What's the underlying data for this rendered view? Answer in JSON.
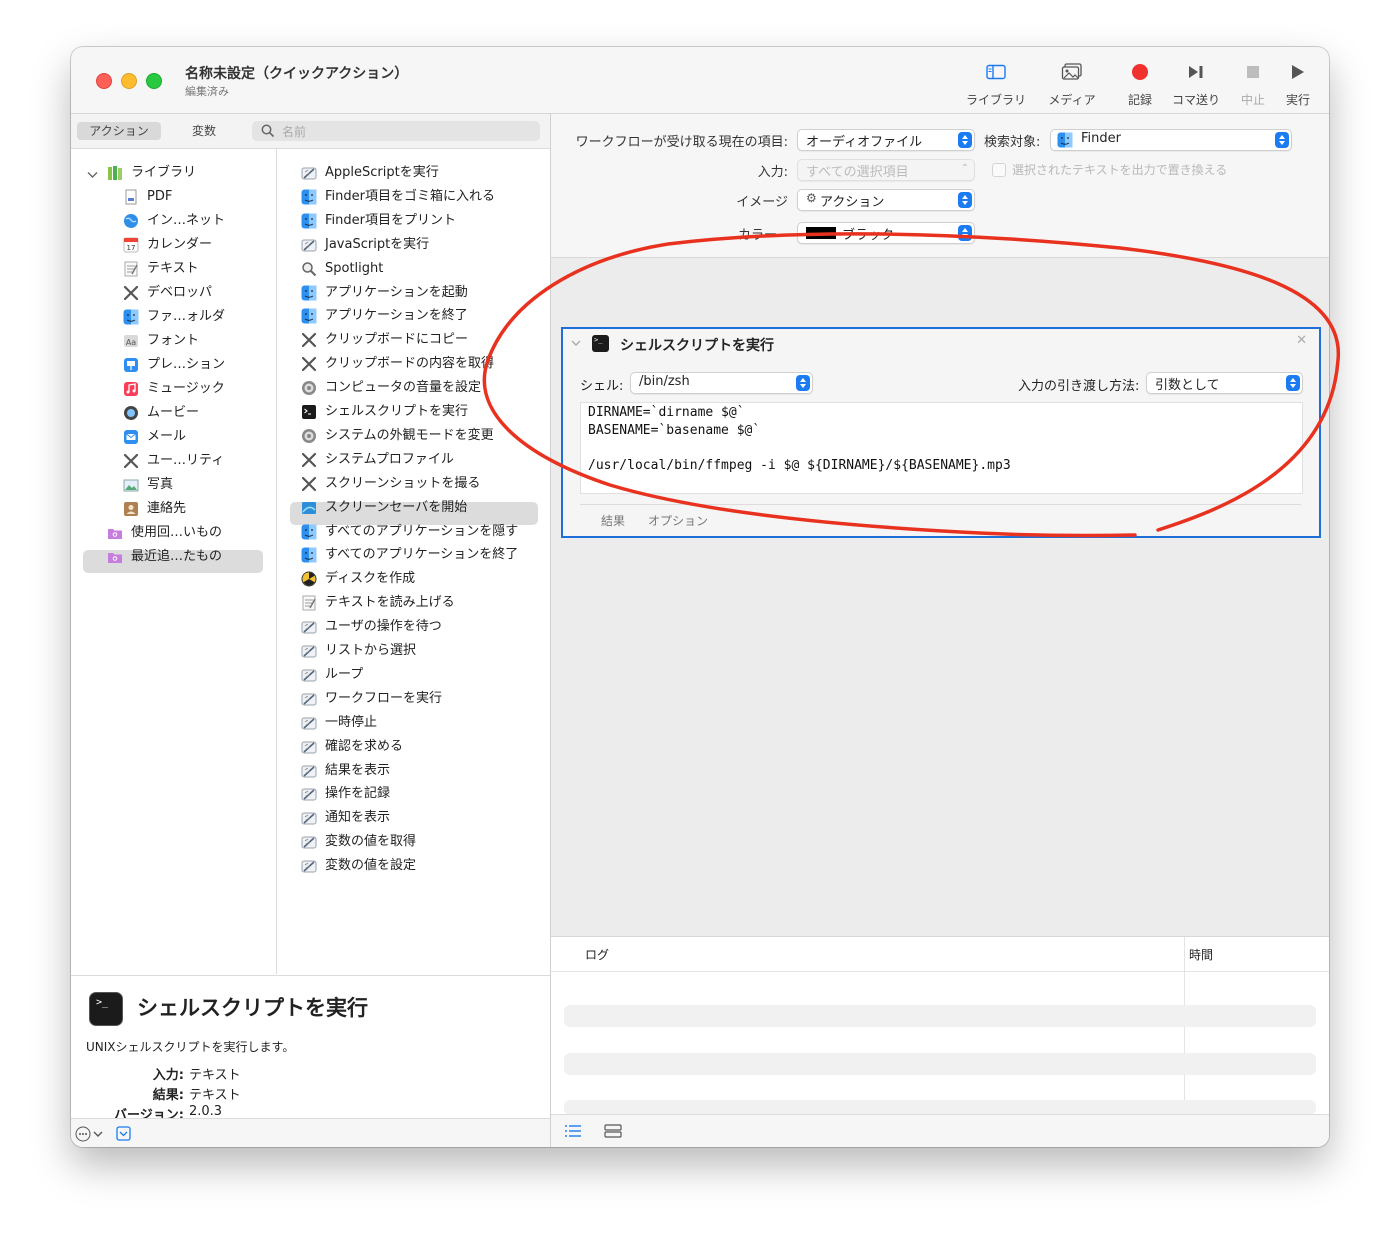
{
  "window": {
    "title": "名称未設定（クイックアクション）",
    "subtitle": "編集済み"
  },
  "toolbar": [
    {
      "label": "ライブラリ",
      "icon": "sidebar-icon"
    },
    {
      "label": "メディア",
      "icon": "media-icon"
    },
    {
      "label": "記録",
      "icon": "record-icon"
    },
    {
      "label": "コマ送り",
      "icon": "step-icon"
    },
    {
      "label": "中止",
      "icon": "stop-icon",
      "disabled": true
    },
    {
      "label": "実行",
      "icon": "play-icon"
    }
  ],
  "left_panel": {
    "segments": [
      "アクション",
      "変数"
    ],
    "selected_segment": "アクション",
    "search_placeholder": "名前"
  },
  "library": [
    {
      "label": "ライブラリ",
      "icon": "library-icon"
    },
    {
      "label": "PDF",
      "icon": "pdf-icon"
    },
    {
      "label": "イン…ネット",
      "icon": "globe-icon"
    },
    {
      "label": "カレンダー",
      "icon": "calendar-icon"
    },
    {
      "label": "テキスト",
      "icon": "text-icon"
    },
    {
      "label": "デベロッパ",
      "icon": "tools-icon"
    },
    {
      "label": "ファ…ォルダ",
      "icon": "finder-icon"
    },
    {
      "label": "フォント",
      "icon": "font-icon"
    },
    {
      "label": "プレ…ション",
      "icon": "keynote-icon"
    },
    {
      "label": "ミュージック",
      "icon": "music-icon"
    },
    {
      "label": "ムービー",
      "icon": "movie-icon"
    },
    {
      "label": "メール",
      "icon": "mail-icon"
    },
    {
      "label": "ユー…リティ",
      "icon": "tools-icon"
    },
    {
      "label": "写真",
      "icon": "photo-icon"
    },
    {
      "label": "連絡先",
      "icon": "contacts-icon"
    },
    {
      "label": "使用回…いもの",
      "icon": "smart-folder-icon"
    },
    {
      "label": "最近追…たもの",
      "icon": "smart-folder-icon"
    }
  ],
  "actions": [
    {
      "label": "AppleScriptを実行",
      "icon": "automator-icon"
    },
    {
      "label": "Finder項目をゴミ箱に入れる",
      "icon": "finder-icon"
    },
    {
      "label": "Finder項目をプリント",
      "icon": "finder-icon"
    },
    {
      "label": "JavaScriptを実行",
      "icon": "automator-icon"
    },
    {
      "label": "Spotlight",
      "icon": "magnifier-icon"
    },
    {
      "label": "アプリケーションを起動",
      "icon": "finder-icon"
    },
    {
      "label": "アプリケーションを終了",
      "icon": "finder-icon"
    },
    {
      "label": "クリップボードにコピー",
      "icon": "tools-icon"
    },
    {
      "label": "クリップボードの内容を取得",
      "icon": "tools-icon"
    },
    {
      "label": "コンピュータの音量を設定",
      "icon": "gear-icon"
    },
    {
      "label": "シェルスクリプトを実行",
      "icon": "terminal-icon"
    },
    {
      "label": "システムの外観モードを変更",
      "icon": "gear-icon"
    },
    {
      "label": "システムプロファイル",
      "icon": "tools-icon"
    },
    {
      "label": "スクリーンショットを撮る",
      "icon": "tools-icon"
    },
    {
      "label": "スクリーンセーバを開始",
      "icon": "screensaver-icon"
    },
    {
      "label": "すべてのアプリケーションを隠す",
      "icon": "finder-icon"
    },
    {
      "label": "すべてのアプリケーションを終了",
      "icon": "finder-icon"
    },
    {
      "label": "ディスクを作成",
      "icon": "disk-icon"
    },
    {
      "label": "テキストを読み上げる",
      "icon": "text-icon"
    },
    {
      "label": "ユーザの操作を待つ",
      "icon": "automator-icon"
    },
    {
      "label": "リストから選択",
      "icon": "automator-icon"
    },
    {
      "label": "ループ",
      "icon": "automator-icon"
    },
    {
      "label": "ワークフローを実行",
      "icon": "automator-icon"
    },
    {
      "label": "一時停止",
      "icon": "automator-icon"
    },
    {
      "label": "確認を求める",
      "icon": "automator-icon"
    },
    {
      "label": "結果を表示",
      "icon": "automator-icon"
    },
    {
      "label": "操作を記録",
      "icon": "automator-icon"
    },
    {
      "label": "通知を表示",
      "icon": "automator-icon"
    },
    {
      "label": "変数の値を取得",
      "icon": "automator-icon"
    },
    {
      "label": "変数の値を設定",
      "icon": "automator-icon"
    }
  ],
  "description": {
    "title": "シェルスクリプトを実行",
    "text": "UNIXシェルスクリプトを実行します。",
    "input_label": "入力:",
    "input_value": "テキスト",
    "result_label": "結果:",
    "result_value": "テキスト",
    "version_label": "バージョン:",
    "version_value": "2.0.3"
  },
  "workflow": {
    "receives_label": "ワークフローが受け取る現在の項目:",
    "receives_value": "オーディオファイル",
    "search_label": "検索対象:",
    "search_value": "Finder",
    "input_label": "入力:",
    "input_value": "すべての選択項目",
    "replace_label": "選択されたテキストを出力で置き換える",
    "image_label": "イメージ",
    "image_value": "アクション",
    "color_label": "カラー",
    "color_value": "ブラック"
  },
  "action_card": {
    "title": "シェルスクリプトを実行",
    "shell_label": "シェル:",
    "shell_value": "/bin/zsh",
    "pass_label": "入力の引き渡し方法:",
    "pass_value": "引数として",
    "code": [
      "DIRNAME=`dirname $@`",
      "BASENAME=`basename $@`",
      "",
      "/usr/local/bin/ffmpeg -i $@ ${DIRNAME}/${BASENAME}.mp3"
    ],
    "tabs": [
      "結果",
      "オプション"
    ]
  },
  "log": {
    "col_log": "ログ",
    "col_time": "時間"
  },
  "colors": {
    "accent": "#1a7bf2",
    "record": "#f0312e",
    "annotation": "#e8321f",
    "card_border": "#1f6fdb"
  }
}
